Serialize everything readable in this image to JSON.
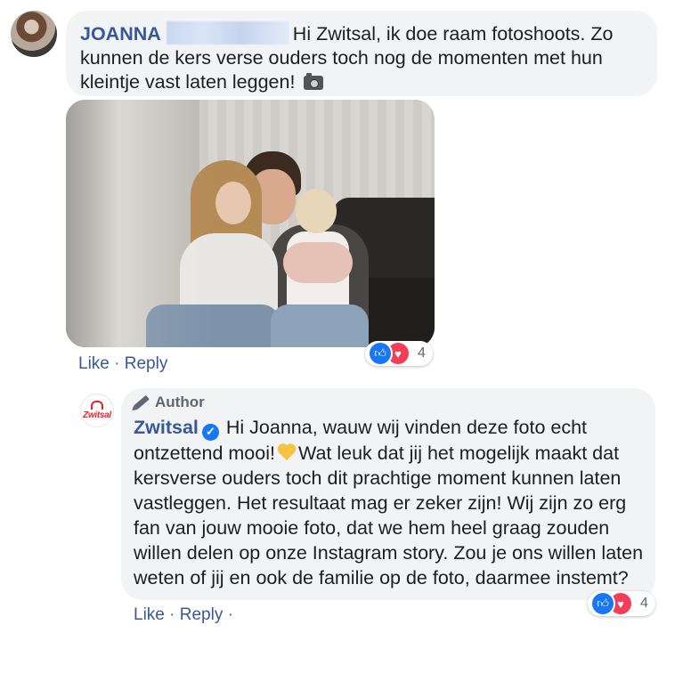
{
  "comment": {
    "author": "JOANNA",
    "text": "Hi Zwitsal, ik doe raam fotoshoots. Zo kunnen de kers verse ouders toch nog de momenten met hun kleintje vast laten leggen!",
    "camera_icon": "camera-emoji",
    "actions": {
      "like": "Like",
      "separator": "·",
      "reply": "Reply"
    },
    "reactions": {
      "types": [
        "like",
        "love"
      ],
      "count": "4"
    }
  },
  "reply": {
    "badge": "Author",
    "author": "Zwitsal",
    "logo_text": "Zwitsal",
    "text_before_emoji": "Hi Joanna, wauw wij vinden deze foto echt ontzettend mooi!",
    "text_after_emoji": "Wat leuk dat jij het mogelijk maakt dat kersverse ouders toch dit prachtige moment kunnen laten vastleggen. Het resultaat mag er zeker zijn! Wij zijn zo erg fan van jouw mooie foto, dat we hem heel graag zouden willen delen op onze Instagram story. Zou je ons willen laten weten of jij en ook de familie op de foto, daarmee instemt?",
    "actions": {
      "like": "Like",
      "separator": "·",
      "reply": "Reply",
      "trailing": "·"
    },
    "reactions": {
      "types": [
        "like",
        "love"
      ],
      "count": "4"
    }
  },
  "colors": {
    "link": "#385898",
    "bubble": "#f2f3f5",
    "like": "#1877f2",
    "love": "#f33e58",
    "brand": "#e3242b"
  }
}
